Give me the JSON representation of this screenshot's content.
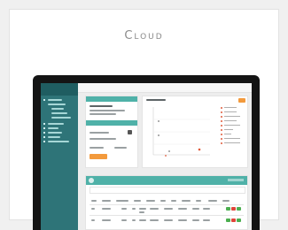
{
  "card": {
    "title": "Cloud"
  },
  "colors": {
    "sidebar": "#2e7478",
    "accent_teal": "#4fb1a8",
    "accent_orange": "#f39a3c",
    "action_green": "#4caf50",
    "action_red": "#e0453a"
  },
  "icons": [
    "laptop-icon"
  ]
}
